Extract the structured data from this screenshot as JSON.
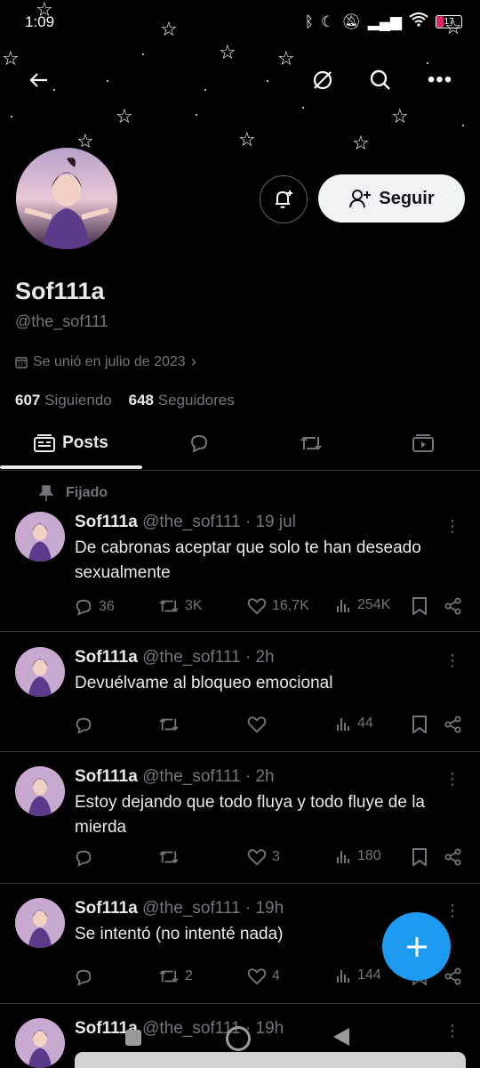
{
  "status": {
    "time": "1:09",
    "battery": "17"
  },
  "profile": {
    "name": "Sof111a",
    "handle": "@the_sof111",
    "joined": "Se unió en julio de 2023",
    "following_count": "607",
    "following_label": "Siguiendo",
    "followers_count": "648",
    "followers_label": "Seguidores",
    "follow_label": "Seguir"
  },
  "tabs": {
    "posts_label": "Posts"
  },
  "pinned_label": "Fijado",
  "posts": [
    {
      "name": "Sof111a",
      "meta": "@the_sof111 · 19 jul",
      "text": "De cabronas aceptar que solo te han deseado sexualmente",
      "replies": "36",
      "reposts": "3K",
      "likes": "16,7K",
      "views": "254K"
    },
    {
      "name": "Sof111a",
      "meta": "@the_sof111 · 2h",
      "text": "Devuélvame al bloqueo emocional",
      "replies": "",
      "reposts": "",
      "likes": "",
      "views": "44"
    },
    {
      "name": "Sof111a",
      "meta": "@the_sof111 · 2h",
      "text": "Estoy dejando que todo fluya y todo fluye de la mierda",
      "replies": "",
      "reposts": "",
      "likes": "3",
      "views": "180"
    },
    {
      "name": "Sof111a",
      "meta": "@the_sof111 · 19h",
      "text": "Se intentó (no intenté nada)",
      "replies": "",
      "reposts": "2",
      "likes": "4",
      "views": "144"
    },
    {
      "name": "Sof111a",
      "meta": "@the_sof111 · 19h",
      "text": "",
      "replies": "",
      "reposts": "",
      "likes": "",
      "views": ""
    }
  ],
  "colors": {
    "accent": "#1d9bf0",
    "background": "#000000",
    "muted": "#71767b"
  }
}
